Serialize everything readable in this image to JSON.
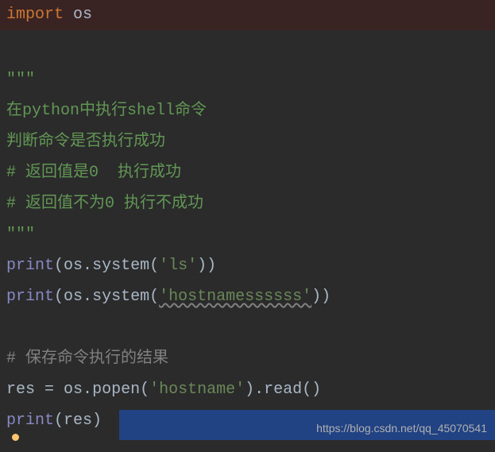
{
  "code": {
    "line1_import": "import",
    "line1_module": " os",
    "triple1": "\"\"\"",
    "doc1_pre": "在",
    "doc1_py": "python",
    "doc1_mid": "中执行",
    "doc1_sh": "shell",
    "doc1_post": "命令",
    "doc2": "判断命令是否执行成功",
    "doc3_hash": "#",
    "doc3_text": " 返回值是0  执行成功",
    "doc4_hash": "#",
    "doc4_text": " 返回值不为0 执行不成功",
    "triple2": "\"\"\"",
    "p1_print": "print",
    "p1_os": "os",
    "p1_dot1": ".",
    "p1_system": "system",
    "p1_str": "'ls'",
    "p2_print": "print",
    "p2_os": "os",
    "p2_dot1": ".",
    "p2_system": "system",
    "p2_str": "'hostnamessssss'",
    "comment_save_hash": "#",
    "comment_save": " 保存命令执行的结果",
    "r1_res": "res ",
    "r1_eq": "= ",
    "r1_os": "os",
    "r1_dot": ".",
    "r1_popen": "popen",
    "r1_str": "'hostname'",
    "r1_dot2": ".",
    "r1_read": "read",
    "r2_print": "print",
    "r2_arg": "res"
  },
  "watermark": "https://blog.csdn.net/qq_45070541"
}
